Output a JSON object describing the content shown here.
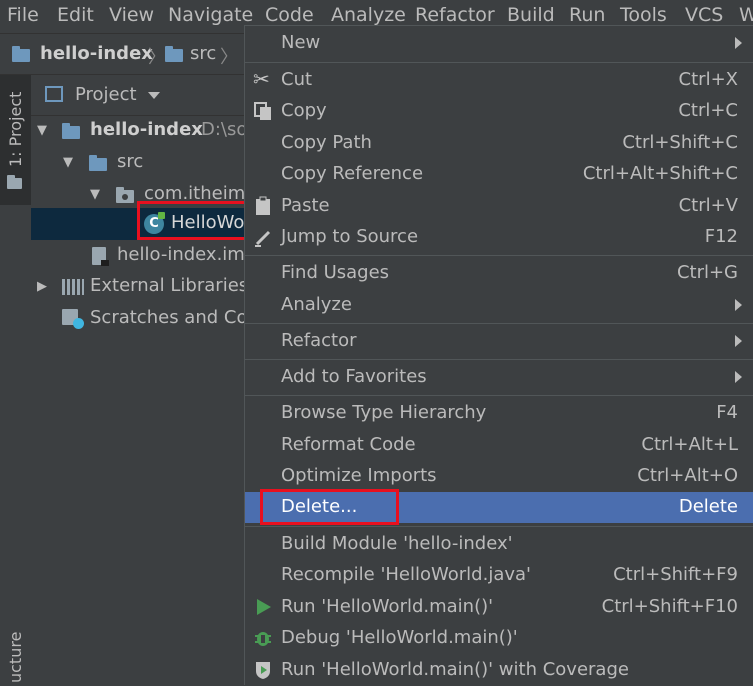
{
  "menubar": {
    "items": [
      "File",
      "Edit",
      "View",
      "Navigate",
      "Code",
      "Analyze",
      "Refactor",
      "Build",
      "Run",
      "Tools",
      "VCS",
      "W"
    ]
  },
  "breadcrumb": {
    "project": "hello-index",
    "folder": "src"
  },
  "side_tabs": {
    "project": "1: Project",
    "structure": "ucture"
  },
  "project_panel": {
    "title": "Project",
    "tree": {
      "root": "hello-index",
      "root_path": "D:\\so",
      "src": "src",
      "package": "com.itheima",
      "class": "HelloWo",
      "iml": "hello-index.iml",
      "external": "External Libraries",
      "scratches": "Scratches and Cor"
    }
  },
  "context_menu": {
    "new": "New",
    "cut": "Cut",
    "cut_sc": "Ctrl+X",
    "copy": "Copy",
    "copy_sc": "Ctrl+C",
    "copy_path": "Copy Path",
    "copy_path_sc": "Ctrl+Shift+C",
    "copy_reference": "Copy Reference",
    "copy_reference_sc": "Ctrl+Alt+Shift+C",
    "paste": "Paste",
    "paste_sc": "Ctrl+V",
    "jump_to_source": "Jump to Source",
    "jump_to_source_sc": "F12",
    "find_usages": "Find Usages",
    "find_usages_sc": "Ctrl+G",
    "analyze": "Analyze",
    "refactor": "Refactor",
    "add_to_favorites": "Add to Favorites",
    "browse_type_hierarchy": "Browse Type Hierarchy",
    "browse_type_hierarchy_sc": "F4",
    "reformat_code": "Reformat Code",
    "reformat_code_sc": "Ctrl+Alt+L",
    "optimize_imports": "Optimize Imports",
    "optimize_imports_sc": "Ctrl+Alt+O",
    "delete": "Delete...",
    "delete_sc": "Delete",
    "build_module": "Build Module 'hello-index'",
    "recompile": "Recompile 'HelloWorld.java'",
    "recompile_sc": "Ctrl+Shift+F9",
    "run": "Run 'HelloWorld.main()'",
    "run_sc": "Ctrl+Shift+F10",
    "debug": "Debug 'HelloWorld.main()'",
    "run_coverage": "Run 'HelloWorld.main()' with Coverage"
  },
  "colors": {
    "background": "#3c3f41",
    "selection": "#4b6eaf",
    "highlight_box": "#e8101f",
    "run_green": "#499c54"
  }
}
